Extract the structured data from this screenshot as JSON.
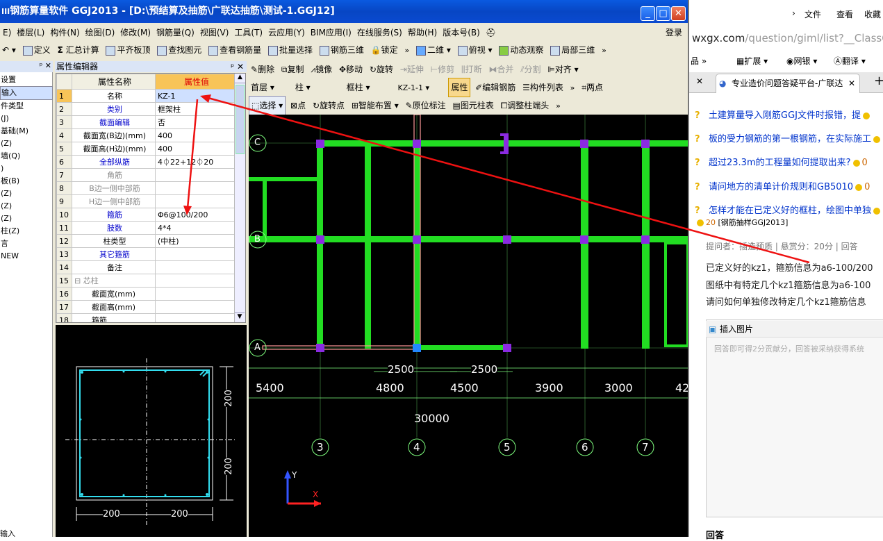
{
  "window": {
    "title": "钢筋算量软件 GGJ2013 - [D:\\预结算及抽筋\\广联达抽筋\\测试-1.GGJ12]",
    "prefix": "III"
  },
  "menu": [
    "E)",
    "楼层(L)",
    "构件(N)",
    "绘图(D)",
    "修改(M)",
    "钢筋量(Q)",
    "视图(V)",
    "工具(T)",
    "云应用(Y)",
    "BIM应用(I)",
    "在线服务(S)",
    "帮助(H)",
    "版本号(B)"
  ],
  "login": "登录",
  "toolbar1": {
    "undo": "",
    "define": "定义",
    "sum": "汇总计算",
    "flat": "平齐板顶",
    "find": "查找图元",
    "view_rebar": "查看钢筋量",
    "batch": "批量选择",
    "rebar3d": "钢筋三维",
    "lock": "锁定",
    "view2d": "二维",
    "top": "俯视",
    "dynamic": "动态观察",
    "local3d": "局部三维"
  },
  "toolbar2": {
    "delete": "删除",
    "copy": "复制",
    "mirror": "镜像",
    "move": "移动",
    "rotate": "旋转",
    "extend": "延伸",
    "trim": "修剪",
    "break": "打断",
    "merge": "合并",
    "split": "分割",
    "align": "对齐"
  },
  "toolbar3": {
    "floor": "首层",
    "type1": "柱",
    "type2": "框柱",
    "element": "KZ-1-1",
    "attr": "属性",
    "edit_rebar": "编辑钢筋",
    "list": "构件列表",
    "two_point": "两点"
  },
  "toolbar4": {
    "select": "选择",
    "point": "点",
    "rot_point": "旋转点",
    "smart": "智能布置",
    "orig": "原位标注",
    "table": "图元柱表",
    "adjust": "调整柱端头"
  },
  "leftpanel": {
    "header": "",
    "rows": [
      "设置",
      "输入",
      "",
      "",
      "件类型",
      "(J)",
      "基础(M)",
      "(Z)",
      "墙(Q)",
      ")",
      "板(B)",
      "",
      "",
      "(Z)",
      "(Z)",
      "(Z)",
      "柱(Z)",
      "",
      "",
      "",
      "言",
      "",
      "",
      "NEW"
    ],
    "bottom": "输入"
  },
  "props": {
    "title": "属性编辑器",
    "col_name": "属性名称",
    "col_value": "属性值",
    "rows": [
      {
        "n": "1",
        "name": "名称",
        "value": "KZ-1",
        "style": "",
        "sel": true
      },
      {
        "n": "2",
        "name": "类别",
        "value": "框架柱",
        "style": "blue"
      },
      {
        "n": "3",
        "name": "截面编辑",
        "value": "否",
        "style": "blue"
      },
      {
        "n": "4",
        "name": "截面宽(B边)(mm)",
        "value": "400",
        "style": ""
      },
      {
        "n": "5",
        "name": "截面高(H边)(mm)",
        "value": "400",
        "style": ""
      },
      {
        "n": "6",
        "name": "全部纵筋",
        "value": "4⏀22+12⏀20",
        "style": "blue"
      },
      {
        "n": "7",
        "name": "角筋",
        "value": "",
        "style": "gray"
      },
      {
        "n": "8",
        "name": "B边一侧中部筋",
        "value": "",
        "style": "gray"
      },
      {
        "n": "9",
        "name": "H边一侧中部筋",
        "value": "",
        "style": "gray"
      },
      {
        "n": "10",
        "name": "箍筋",
        "value": "Φ6@100/200",
        "style": "blue"
      },
      {
        "n": "11",
        "name": "肢数",
        "value": "4*4",
        "style": "blue"
      },
      {
        "n": "12",
        "name": "柱类型",
        "value": "(中柱)",
        "style": ""
      },
      {
        "n": "13",
        "name": "其它箍筋",
        "value": "",
        "style": "blue"
      },
      {
        "n": "14",
        "name": "备注",
        "value": "",
        "style": ""
      },
      {
        "n": "15",
        "name": "⊟ 芯柱",
        "value": "",
        "style": "gray"
      },
      {
        "n": "16",
        "name": "截面宽(mm)",
        "value": "",
        "style": ""
      },
      {
        "n": "17",
        "name": "截面高(mm)",
        "value": "",
        "style": ""
      },
      {
        "n": "18",
        "name": "箍筋",
        "value": "",
        "style": ""
      }
    ]
  },
  "section": {
    "dim_h1": "200",
    "dim_h2": "200",
    "dim_v1": "200",
    "dim_v2": "200"
  },
  "drawing": {
    "axis_rows": [
      "C",
      "B",
      "A"
    ],
    "axis_cols": [
      "3",
      "4",
      "5",
      "6",
      "7"
    ],
    "spans": [
      "5400",
      "4800",
      "4500",
      "3900",
      "3000",
      "42"
    ],
    "sub_spans": [
      "2500",
      "2500"
    ],
    "total": "30000",
    "ucs": {
      "x": "X",
      "y": "Y"
    }
  },
  "browser": {
    "menu": [
      "文件",
      "查看",
      "收藏"
    ],
    "address_host": "wxgx.com",
    "address_path": "/question/giml/list?__ClassCode",
    "toolbar": [
      "扩展",
      "网银",
      "翻译"
    ],
    "tab_title": "专业造价问题答疑平台-广联达",
    "questions": [
      {
        "text": "土建算量导入刚筋GGJ文件时报错，提",
        "coin": ""
      },
      {
        "text": "板的受力钢筋的第一根钢筋，在实际施工",
        "coin": ""
      },
      {
        "text": "超过23.3m的工程量如何提取出来?",
        "coin": "0"
      },
      {
        "text": "请问地方的清单计价规则和GB5010",
        "coin": "0"
      },
      {
        "text": "怎样才能在已定义好的框柱，绘图中单独",
        "coin": ""
      }
    ],
    "last_coin": "20",
    "last_tag": "[钢筋抽样GGJ2013]",
    "meta": "提问者：插造预质  |  悬赏分：20分  |  回答",
    "body": [
      "已定义好的kz1，箍筋信息为a6-100/200",
      "图纸中有特定几个kz1箍筋信息为a6-100",
      "请问如何单独修改特定几个kz1箍筋信息"
    ],
    "insert_image": "插入图片",
    "answer_placeholder": "回答即可得2分贡献分，回答被采纳获得系统",
    "answer_label": "回答"
  },
  "colors": {
    "title": "#0a5ae0",
    "accent": "#f8c458",
    "beam": "#22dd22",
    "column": "#8a2be2",
    "red_arrow": "#ee1111",
    "cyan": "#33ddee"
  }
}
